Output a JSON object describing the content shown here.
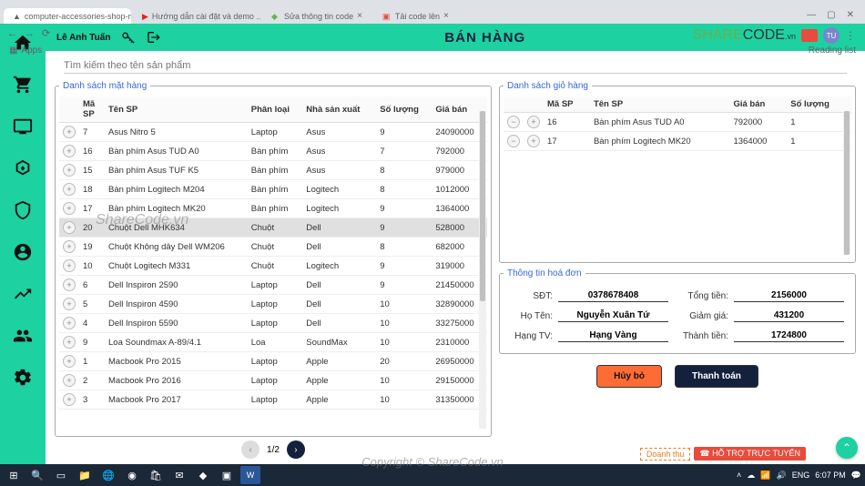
{
  "browser": {
    "tabs": [
      {
        "icon": "△",
        "label": "computer-accessories-shop-ma…"
      },
      {
        "icon": "▶",
        "label": "Hướng dẫn cài đặt và demo …"
      },
      {
        "icon": "◆",
        "label": "Sửa thông tin code"
      },
      {
        "icon": "▣",
        "label": "Tải code lên"
      }
    ],
    "bookmark_apps": "Apps",
    "reading_list": "Reading list",
    "avatar": "TU"
  },
  "app": {
    "user": "Lê Anh Tuấn",
    "title": "BÁN HÀNG",
    "search_placeholder": "Tìm kiếm theo tên sản phẩm",
    "panels": {
      "products": "Danh sách mặt hàng",
      "cart": "Danh sách giỏ hàng",
      "invoice": "Thông tin hoá đơn"
    },
    "product_headers": {
      "sp": "Mã SP",
      "ten": "Tên SP",
      "loai": "Phân loại",
      "nsx": "Nhà sản xuất",
      "sl": "Số lượng",
      "gia": "Giá bán"
    },
    "products": [
      {
        "sp": "7",
        "ten": "Asus Nitro 5",
        "loai": "Laptop",
        "nsx": "Asus",
        "sl": "9",
        "gia": "24090000"
      },
      {
        "sp": "16",
        "ten": "Bàn phím Asus TUD A0",
        "loai": "Bàn phím",
        "nsx": "Asus",
        "sl": "7",
        "gia": "792000"
      },
      {
        "sp": "15",
        "ten": "Bàn phím Asus TUF K5",
        "loai": "Bàn phím",
        "nsx": "Asus",
        "sl": "8",
        "gia": "979000"
      },
      {
        "sp": "18",
        "ten": "Bàn phím Logitech M204",
        "loai": "Bàn phím",
        "nsx": "Logitech",
        "sl": "8",
        "gia": "1012000"
      },
      {
        "sp": "17",
        "ten": "Bàn phím Logitech MK20",
        "loai": "Bàn phím",
        "nsx": "Logitech",
        "sl": "9",
        "gia": "1364000"
      },
      {
        "sp": "20",
        "ten": "Chuột Dell MHK634",
        "loai": "Chuột",
        "nsx": "Dell",
        "sl": "9",
        "gia": "528000",
        "hl": true
      },
      {
        "sp": "19",
        "ten": "Chuột Không dây Dell WM206",
        "loai": "Chuột",
        "nsx": "Dell",
        "sl": "8",
        "gia": "682000"
      },
      {
        "sp": "10",
        "ten": "Chuột Logitech M331",
        "loai": "Chuột",
        "nsx": "Logitech",
        "sl": "9",
        "gia": "319000"
      },
      {
        "sp": "6",
        "ten": "Dell Inspiron 2590",
        "loai": "Laptop",
        "nsx": "Dell",
        "sl": "9",
        "gia": "21450000"
      },
      {
        "sp": "5",
        "ten": "Dell Inspiron 4590",
        "loai": "Laptop",
        "nsx": "Dell",
        "sl": "10",
        "gia": "32890000"
      },
      {
        "sp": "4",
        "ten": "Dell Inspiron 5590",
        "loai": "Laptop",
        "nsx": "Dell",
        "sl": "10",
        "gia": "33275000"
      },
      {
        "sp": "9",
        "ten": "Loa Soundmax A-89/4.1",
        "loai": "Loa",
        "nsx": "SoundMax",
        "sl": "10",
        "gia": "2310000"
      },
      {
        "sp": "1",
        "ten": "Macbook Pro 2015",
        "loai": "Laptop",
        "nsx": "Apple",
        "sl": "20",
        "gia": "26950000"
      },
      {
        "sp": "2",
        "ten": "Macbook Pro 2016",
        "loai": "Laptop",
        "nsx": "Apple",
        "sl": "10",
        "gia": "29150000"
      },
      {
        "sp": "3",
        "ten": "Macbook Pro 2017",
        "loai": "Laptop",
        "nsx": "Apple",
        "sl": "10",
        "gia": "31350000"
      }
    ],
    "pager": "1/2",
    "cart_headers": {
      "sp": "Mã SP",
      "ten": "Tên SP",
      "gia": "Giá bán",
      "sl": "Số lượng"
    },
    "cart": [
      {
        "sp": "16",
        "ten": "Bàn phím Asus TUD A0",
        "gia": "792000",
        "sl": "1"
      },
      {
        "sp": "17",
        "ten": "Bàn phím Logitech MK20",
        "gia": "1364000",
        "sl": "1"
      }
    ],
    "invoice": {
      "sdt_label": "SĐT:",
      "sdt": "0378678408",
      "tong_label": "Tổng tiền:",
      "tong": "2156000",
      "hoten_label": "Họ Tên:",
      "hoten": "Nguyễn Xuân Tứ",
      "giam_label": "Giảm giá:",
      "giam": "431200",
      "hang_label": "Hạng TV:",
      "hang": "Hạng Vàng",
      "thanh_label": "Thành tiền:",
      "thanh": "1724800"
    },
    "buttons": {
      "cancel": "Hủy bỏ",
      "pay": "Thanh toán"
    }
  },
  "watermark": "ShareCode.vn",
  "copyright": "Copyright © ShareCode.vn",
  "banner": {
    "dth": "Doanh thu",
    "support": "☎ HỖ TRỢ TRỰC TUYẾN"
  },
  "taskbar": {
    "time": "6:07 PM",
    "lang": "ENG"
  }
}
